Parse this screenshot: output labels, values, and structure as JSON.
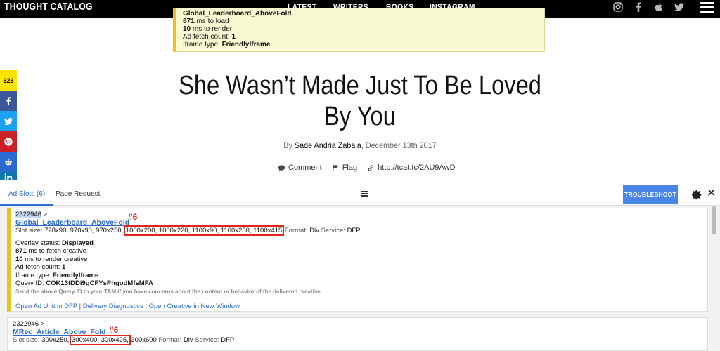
{
  "nav": {
    "logo": "THOUGHT CATALOG",
    "links": [
      "LATEST",
      "WRITERS",
      "BOOKS",
      "INSTAGRAM"
    ]
  },
  "overlay": {
    "slot_name": "Global_Leaderboard_AboveFold",
    "load_value": "871",
    "load_text": " ms to load",
    "render_value": "10",
    "render_text": " ms to render",
    "fetch_label": "Ad fetch count: ",
    "fetch_value": "1",
    "iframe_label": "Iframe type: ",
    "iframe_value": "FriendlyIframe"
  },
  "sidebar": {
    "share_count": "623",
    "buttons": [
      {
        "icon": "facebook-icon",
        "color": "#3b5998"
      },
      {
        "icon": "twitter-icon",
        "color": "#1da1f2"
      },
      {
        "icon": "pinterest-icon",
        "color": "#cb2027"
      },
      {
        "icon": "reddit-icon",
        "color": "#2a6ad1"
      },
      {
        "icon": "linkedin-icon",
        "color": "#0e76a8"
      }
    ]
  },
  "article": {
    "title_line1": "She Wasn’t Made Just To Be Loved",
    "title_line2": "By You",
    "by": "By ",
    "author": "Sade Andria Zabala",
    "date": ", December 13th 2017",
    "comment": "Comment",
    "flag": "Flag",
    "short_link": "http://tcat.tc/2AU9AwD"
  },
  "panel": {
    "tab_ad_slots": "Ad Slots (6)",
    "tab_page_request": "Page Request",
    "troubleshoot": "TROUBLESHOOT",
    "close": "✕"
  },
  "slots": [
    {
      "ad_unit_id": "2322946",
      "arrow": " >",
      "name": "Global_Leaderboard_AboveFold",
      "annotation": "#6",
      "size_label": "Slot size: ",
      "sizes_plain": "728x90, 970x90, 970x250, ",
      "sizes_highlight": "1000x200, 1000x220, 1100x90, 1100x250, 1100x415",
      "format_label": "Format: ",
      "format": "Div",
      "service_label": "Service: ",
      "service": "DFP",
      "overlay_label": "Overlay status: ",
      "overlay_status": "Displayed",
      "fetch_ms": "871",
      "fetch_text": " ms to fetch creative",
      "render_ms": "10",
      "render_text": " ms to render creative",
      "fetch_count_label": "Ad fetch count: ",
      "fetch_count": "1",
      "iframe_label": "Iframe type: ",
      "iframe": "FriendlyIframe",
      "query_label": "Query ID: ",
      "query_id": "COK13tDDi9gCFYsPhgodMfsMFA",
      "note": "Send the above Query ID to your TAM if you have concerns about the content or behavior of the delivered creative.",
      "link1": "Open Ad Unit in DFP",
      "link2": "Delivery Diagnostics",
      "link3": "Open Creative in New Window"
    },
    {
      "ad_unit_id": "2322946",
      "arrow": " >",
      "name": "MRec_Article_Above_Fold",
      "annotation": "#6",
      "size_label": "Slot size: ",
      "sizes_plain_before": "300x250, ",
      "sizes_highlight": "300x400, 300x425,",
      "sizes_plain_after": " 300x600",
      "format_label": "Format: ",
      "format": "Div",
      "service_label": "Service: ",
      "service": "DFP"
    }
  ],
  "separator": " | "
}
